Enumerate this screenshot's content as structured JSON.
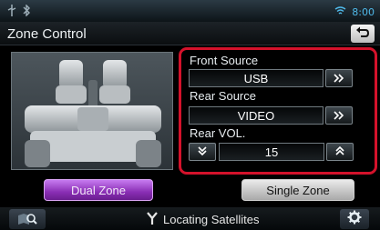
{
  "status_bar": {
    "time": "8:00",
    "icons": [
      "usb-icon",
      "bluetooth-icon",
      "wifi-icon"
    ]
  },
  "header": {
    "title": "Zone Control",
    "back_icon": "back-arrow-icon"
  },
  "zone": {
    "front_source_label": "Front Source",
    "front_source_value": "USB",
    "rear_source_label": "Rear Source",
    "rear_source_value": "VIDEO",
    "rear_vol_label": "Rear VOL.",
    "rear_vol_value": "15",
    "next_icon": "double-chevron-right-icon",
    "down_icon": "double-chevron-down-icon",
    "up_icon": "double-chevron-up-icon"
  },
  "buttons": {
    "dual_zone": "Dual Zone",
    "single_zone": "Single Zone"
  },
  "footer": {
    "status_text": "Locating Satellites",
    "status_icon": "satellite-icon",
    "search_icon": "map-search-icon",
    "settings_icon": "gear-icon"
  },
  "colors": {
    "highlight": "#d4122b",
    "dual_zone_active": "#8a2fb5",
    "accent_blue": "#4fb8e8"
  }
}
